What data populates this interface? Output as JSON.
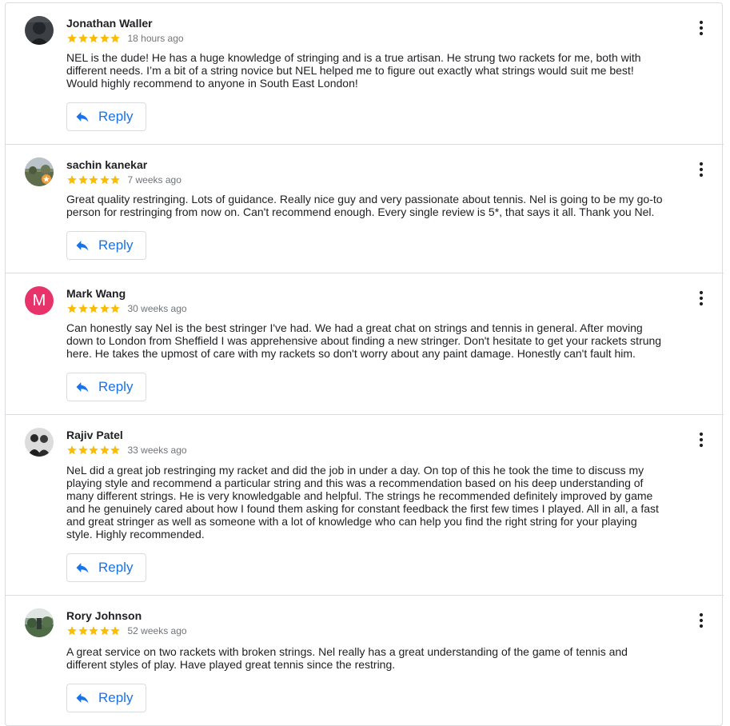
{
  "colors": {
    "star": "#fbbc04",
    "accent": "#1a73e8",
    "meta_text": "#70757a",
    "border": "#dadce0"
  },
  "icons": {
    "star": "star-icon",
    "reply": "reply-arrow-icon",
    "more": "more-vert-icon"
  },
  "reviews": [
    {
      "name": "Jonathan Waller",
      "rating": 5,
      "time": "18 hours ago",
      "text": "NEL is the dude! He has a huge knowledge of stringing and is a true artisan. He strung two rackets for me, both with different needs. I’m a bit of a string novice but NEL helped me to figure out exactly what strings would suit me best! Would highly recommend to anyone in South East London!",
      "reply_label": "Reply"
    },
    {
      "name": "sachin kanekar",
      "rating": 5,
      "time": "7 weeks ago",
      "text": "Great quality restringing. Lots of guidance. Really nice guy and very passionate about tennis. Nel is going to be my go-to person for restringing from now on. Can't recommend enough. Every single review is 5*, that says it all. Thank you Nel.",
      "reply_label": "Reply"
    },
    {
      "name": "Mark Wang",
      "avatar_letter": "M",
      "avatar_color": "#e8336a",
      "rating": 5,
      "time": "30 weeks ago",
      "text": "Can honestly say Nel is the best stringer I've had. We had a great chat on strings and tennis in general. After moving down to London from Sheffield I was apprehensive about finding a new stringer. Don't hesitate to get your rackets strung here. He takes the upmost of care with my rackets so don't worry about any paint damage. Honestly can't fault him.",
      "reply_label": "Reply"
    },
    {
      "name": "Rajiv Patel",
      "rating": 5,
      "time": "33 weeks ago",
      "text": "NeL did a great job restringing my racket and did the job in under a day. On top of this he took the time to discuss my playing style and recommend a particular string and this was a recommendation based on his deep understanding of many different strings. He is very knowledgable and helpful. The strings he recommended definitely improved by game and he genuinely cared about how I found them asking for constant feedback the first few times I played. All in all, a fast and great stringer as well as someone with a lot of knowledge who can help you find the right string for your playing style. Highly recommended.",
      "reply_label": "Reply"
    },
    {
      "name": "Rory Johnson",
      "rating": 5,
      "time": "52 weeks ago",
      "text": "A great service on two rackets with broken strings. Nel really has a great understanding of the game of tennis and different styles of play. Have played great tennis since the restring.",
      "reply_label": "Reply"
    }
  ]
}
